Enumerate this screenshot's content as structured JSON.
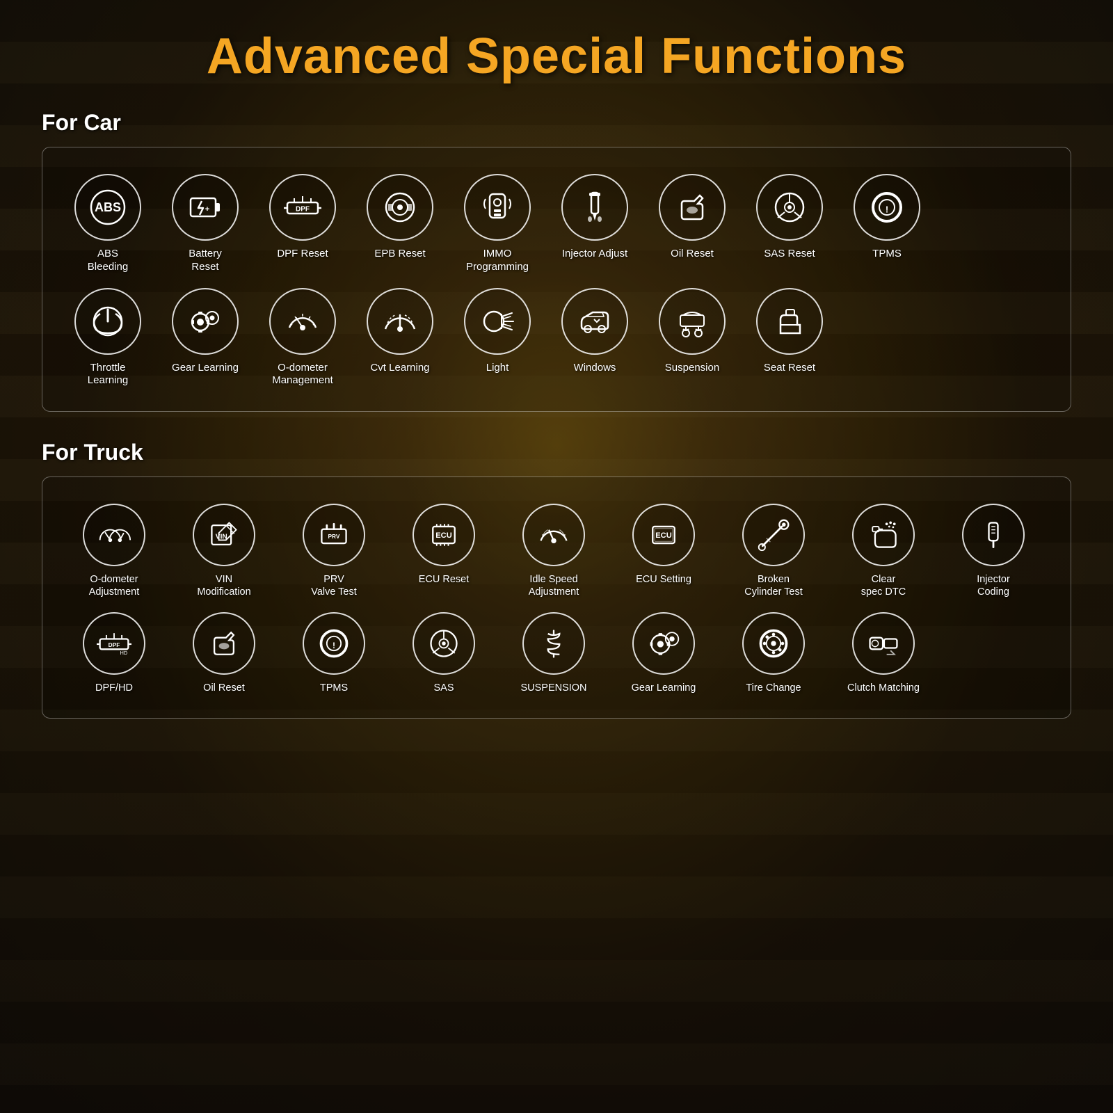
{
  "title": "Advanced Special Functions",
  "sections": [
    {
      "id": "car",
      "heading": "For Car",
      "rows": [
        [
          {
            "id": "abs-bleeding",
            "label": "ABS\nBleeding",
            "icon": "abs"
          },
          {
            "id": "battery-reset",
            "label": "Battery\nReset",
            "icon": "battery"
          },
          {
            "id": "dpf-reset",
            "label": "DPF Reset",
            "icon": "dpf"
          },
          {
            "id": "epb-reset",
            "label": "EPB Reset",
            "icon": "epb"
          },
          {
            "id": "immo-programming",
            "label": "IMMO\nProgramming",
            "icon": "immo"
          },
          {
            "id": "injector-adjust",
            "label": "Injector Adjust",
            "icon": "injector"
          },
          {
            "id": "oil-reset",
            "label": "Oil Reset",
            "icon": "oil"
          },
          {
            "id": "sas-reset",
            "label": "SAS Reset",
            "icon": "sas"
          },
          {
            "id": "tpms",
            "label": "TPMS",
            "icon": "tpms"
          }
        ],
        [
          {
            "id": "throttle-learning",
            "label": "Throttle\nLearning",
            "icon": "throttle"
          },
          {
            "id": "gear-learning",
            "label": "Gear Learning",
            "icon": "gear"
          },
          {
            "id": "odometer-management",
            "label": "O-dometer\nManagement",
            "icon": "odometer"
          },
          {
            "id": "cvt-learning",
            "label": "Cvt Learning",
            "icon": "cvt"
          },
          {
            "id": "light",
            "label": "Light",
            "icon": "light"
          },
          {
            "id": "windows",
            "label": "Windows",
            "icon": "windows"
          },
          {
            "id": "suspension",
            "label": "Suspension",
            "icon": "suspension"
          },
          {
            "id": "seat-reset",
            "label": "Seat Reset",
            "icon": "seat"
          }
        ]
      ]
    },
    {
      "id": "truck",
      "heading": "For Truck",
      "rows": [
        [
          {
            "id": "odometer-adjustment",
            "label": "O-dometer\nAdjustment",
            "icon": "odometer2"
          },
          {
            "id": "vin-modification",
            "label": "VIN\nModification",
            "icon": "vin"
          },
          {
            "id": "prv-valve-test",
            "label": "PRV\nValve Test",
            "icon": "prv"
          },
          {
            "id": "ecu-reset",
            "label": "ECU Reset",
            "icon": "ecureset"
          },
          {
            "id": "idle-speed-adjustment",
            "label": "Idle Speed\nAdjustment",
            "icon": "idle"
          },
          {
            "id": "ecu-setting",
            "label": "ECU Setting",
            "icon": "ecusetting"
          },
          {
            "id": "broken-cylinder-test",
            "label": "Broken\nCylinder Test",
            "icon": "cylinder"
          },
          {
            "id": "clear-spec-dtc",
            "label": "Clear\nspec DTC",
            "icon": "cleardtc"
          },
          {
            "id": "injector-coding",
            "label": "Injector\nCoding",
            "icon": "injector2"
          }
        ],
        [
          {
            "id": "dpf-hd",
            "label": "DPF/HD",
            "icon": "dpfhd"
          },
          {
            "id": "oil-reset-truck",
            "label": "Oil Reset",
            "icon": "oiltruck"
          },
          {
            "id": "tpms-truck",
            "label": "TPMS",
            "icon": "tpmstruck"
          },
          {
            "id": "sas-truck",
            "label": "SAS",
            "icon": "sastruck"
          },
          {
            "id": "suspension-truck",
            "label": "SUSPENSION",
            "icon": "suspensiontruck"
          },
          {
            "id": "gear-learning-truck",
            "label": "Gear Learning",
            "icon": "geartruck"
          },
          {
            "id": "tire-change",
            "label": "Tire Change",
            "icon": "tirechange"
          },
          {
            "id": "clutch-matching",
            "label": "Clutch Matching",
            "icon": "clutch"
          }
        ]
      ]
    }
  ]
}
